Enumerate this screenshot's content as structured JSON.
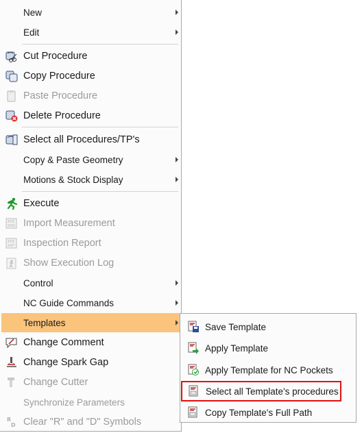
{
  "menu": {
    "items": [
      {
        "label": "New",
        "icon": "none",
        "submenu": true
      },
      {
        "label": "Edit",
        "icon": "none",
        "submenu": true
      },
      {
        "label": "Cut  Procedure",
        "icon": "cut-procedure-icon"
      },
      {
        "label": "Copy Procedure",
        "icon": "copy-procedure-icon"
      },
      {
        "label": "Paste Procedure",
        "icon": "paste-procedure-icon",
        "disabled": true
      },
      {
        "label": "Delete Procedure",
        "icon": "delete-procedure-icon"
      },
      {
        "label": "Select all Procedures/TP's",
        "icon": "select-all-procedures-icon"
      },
      {
        "label": "Copy & Paste Geometry",
        "icon": "none",
        "submenu": true
      },
      {
        "label": "Motions & Stock Display",
        "icon": "none",
        "submenu": true
      },
      {
        "label": "Execute",
        "icon": "execute-runner-icon"
      },
      {
        "label": "Import Measurement",
        "icon": "import-measurement-icon",
        "disabled": true
      },
      {
        "label": "Inspection Report",
        "icon": "inspection-report-icon",
        "disabled": true
      },
      {
        "label": "Show Execution Log",
        "icon": "execution-log-icon",
        "disabled": true
      },
      {
        "label": "Control",
        "icon": "none",
        "submenu": true
      },
      {
        "label": "NC Guide Commands",
        "icon": "none",
        "submenu": true
      },
      {
        "label": "Templates",
        "icon": "none",
        "submenu": true,
        "highlighted": true
      },
      {
        "label": "Change Comment",
        "icon": "change-comment-icon"
      },
      {
        "label": "Change Spark Gap",
        "icon": "spark-gap-icon"
      },
      {
        "label": "Change Cutter",
        "icon": "cutter-icon",
        "disabled": true
      },
      {
        "label": "Synchronize Parameters",
        "icon": "none",
        "disabled": true
      },
      {
        "label": "Clear \"R\" and \"D\" Symbols",
        "icon": "rd-symbols-icon",
        "disabled": true
      }
    ]
  },
  "templates_submenu": {
    "items": [
      {
        "label": "Save Template",
        "icon": "save-template-icon"
      },
      {
        "label": "Apply Template",
        "icon": "apply-template-icon"
      },
      {
        "label": "Apply Template for NC Pockets",
        "icon": "apply-template-pockets-icon"
      },
      {
        "label": "Select all Template's procedures",
        "icon": "select-template-procedures-icon",
        "selected": true
      },
      {
        "label": "Copy Template's Full Path",
        "icon": "copy-template-path-icon"
      }
    ]
  },
  "colors": {
    "highlight": "#fbc47c",
    "selection_border": "#e01010",
    "disabled_text": "#9a9a9a",
    "execute_green": "#1a9a2a"
  }
}
